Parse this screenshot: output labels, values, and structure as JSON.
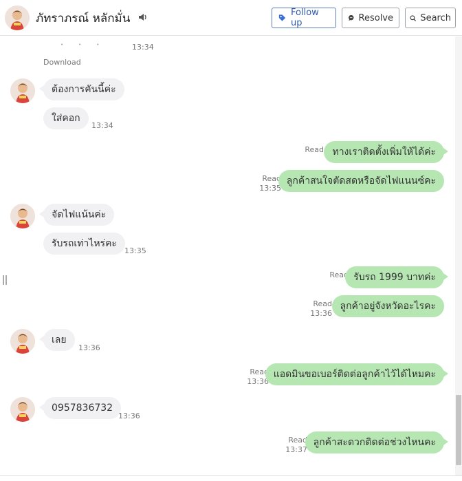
{
  "contact": {
    "name": "ภัทราภรณ์ หลักมั่น"
  },
  "actions": {
    "follow_up": "Follow up",
    "resolve": "Resolve",
    "search": "Search"
  },
  "attachment": {
    "time": "13:34",
    "download": "Download"
  },
  "messages": [
    {
      "dir": "in",
      "text": "ต้องการคันนี้ค่ะ",
      "time": ""
    },
    {
      "dir": "in",
      "text": "ใส่คอก",
      "time": "13:34"
    },
    {
      "dir": "out",
      "text": "ทางเราติดตั้งเพิ่มให้ได้ค่ะ",
      "status": "Read",
      "time": ""
    },
    {
      "dir": "out",
      "text": "ลูกค้าสนใจตัดสดหรือจัดไฟแนนซ์คะ",
      "status": "Read",
      "time": "13:35"
    },
    {
      "dir": "in",
      "text": "จัดไฟแน้นค่ะ",
      "time": ""
    },
    {
      "dir": "in",
      "text": "รับรถเท่าไหร่คะ",
      "time": "13:35"
    },
    {
      "dir": "out",
      "text": "รับรถ 1999 บาทค่ะ",
      "status": "Read",
      "time": ""
    },
    {
      "dir": "out",
      "text": "ลูกค้าอยู่จังหวัดอะไรคะ",
      "status": "Read",
      "time": "13:36"
    },
    {
      "dir": "in",
      "text": "เลย",
      "time": "13:36"
    },
    {
      "dir": "out",
      "text": "แอดมินขอเบอร์ติดต่อลูกค้าไว้ได้ไหมคะ",
      "status": "Read",
      "time": "13:36"
    },
    {
      "dir": "in",
      "text": "0957836732",
      "time": "13:36"
    },
    {
      "dir": "out",
      "text": "ลูกค้าสะดวกติดต่อช่วงไหนคะ",
      "status": "Read",
      "time": "13:37"
    }
  ],
  "icons": {
    "speaker": "speaker-icon",
    "follow": "tag-icon",
    "resolve": "chat-bubble-icon",
    "search": "search-icon"
  },
  "colors": {
    "outgoing": "#b6e7b3",
    "incoming": "#f1f1f3",
    "accent": "#2f5aa8"
  }
}
